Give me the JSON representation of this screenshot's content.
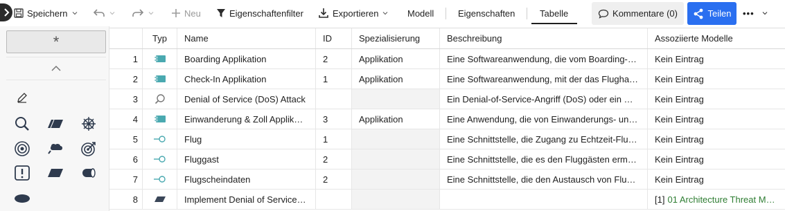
{
  "toolbar": {
    "save_label": "Speichern",
    "new_label": "Neu",
    "filter_label": "Eigenschaftenfilter",
    "export_label": "Exportieren",
    "tab_model": "Modell",
    "tab_properties": "Eigenschaften",
    "tab_table": "Tabelle",
    "active_tab": "Tabelle",
    "comments_label": "Kommentare (0)",
    "share_label": "Teilen",
    "more_label": "•••"
  },
  "palette": {
    "asterisk": "*",
    "icons": [
      "pencil-icon",
      "magnifier-icon",
      "parallelogram-icon",
      "wheel-icon",
      "target-icon",
      "cloud-icon",
      "target-arrow-icon",
      "warning-square-icon",
      "parallelogram-solid-icon",
      "cylinder-icon",
      "ellipse-icon"
    ]
  },
  "table": {
    "columns": [
      "Typ",
      "Name",
      "ID",
      "Spezialisierung",
      "Beschreibung",
      "Assoziierte Modelle"
    ],
    "rows": [
      {
        "num": "1",
        "type": "application-icon",
        "name": "Boarding Applikation",
        "id": "2",
        "spec": "Applikation",
        "desc": "Eine Softwareanwendung, die vom Boarding-…",
        "models": "Kein Eintrag"
      },
      {
        "num": "2",
        "type": "application-icon",
        "name": "Check-In Applikation",
        "id": "1",
        "spec": "Applikation",
        "desc": "Eine Softwareanwendung, mit der das Flugha…",
        "models": "Kein Eintrag"
      },
      {
        "num": "3",
        "type": "magnifier-icon",
        "name": "Denial of Service (DoS) Attack",
        "id": "",
        "spec": "",
        "desc": "Ein Denial-of-Service-Angriff (DoS) oder ein …",
        "models": "Kein Eintrag"
      },
      {
        "num": "4",
        "type": "application-icon",
        "name": "Einwanderung & Zoll Applik…",
        "id": "3",
        "spec": "Applikation",
        "desc": "Eine Anwendung, die von Einwanderungs- un…",
        "models": "Kein Eintrag"
      },
      {
        "num": "5",
        "type": "interface-icon",
        "name": "Flug",
        "id": "1",
        "spec": "",
        "desc": "Eine Schnittstelle, die Zugang zu Echtzeit-Flu…",
        "models": "Kein Eintrag"
      },
      {
        "num": "6",
        "type": "interface-icon",
        "name": "Fluggast",
        "id": "2",
        "spec": "",
        "desc": "Eine Schnittstelle, die es den Fluggästen erm…",
        "models": "Kein Eintrag"
      },
      {
        "num": "7",
        "type": "interface-icon",
        "name": "Flugscheindaten",
        "id": "2",
        "spec": "",
        "desc": "Eine Schnittstelle, die den Austausch von Flu…",
        "models": "Kein Eintrag"
      },
      {
        "num": "8",
        "type": "parallelogram-icon",
        "name": "Implement Denial of Service…",
        "id": "",
        "spec": "",
        "desc": "",
        "models_prefix": "[1]",
        "models_link": "01 Architecture Threat M…"
      }
    ]
  },
  "colors": {
    "accent": "#2a6ff0",
    "link": "#2e7d32",
    "icon_teal": "#4aa9b0"
  }
}
